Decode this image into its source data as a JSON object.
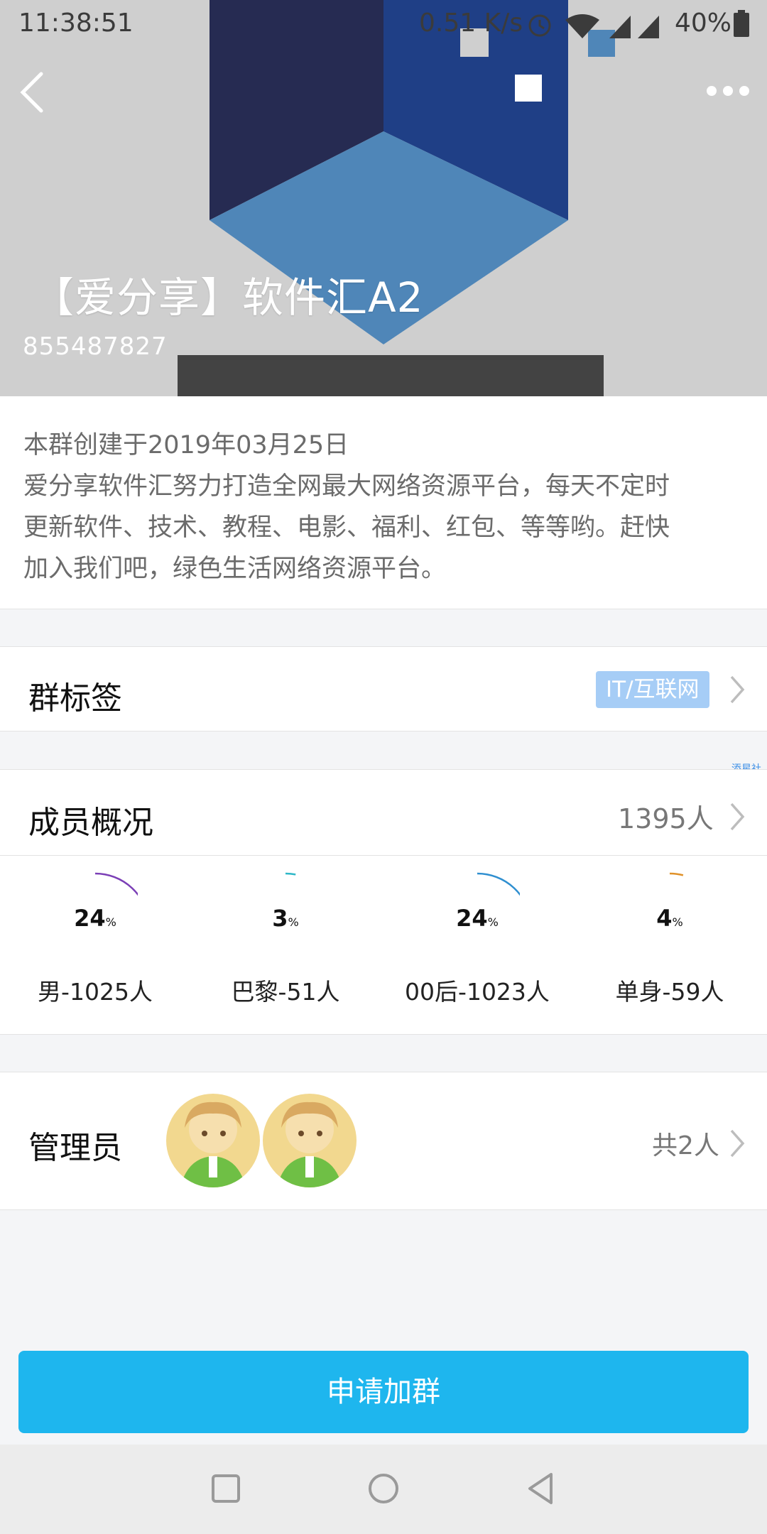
{
  "status_bar": {
    "time": "11:38:51",
    "network_speed": "0.51 K/s",
    "battery": "40%"
  },
  "header": {
    "title": "【爱分享】软件汇A2",
    "group_id": "855487827",
    "cover_icon": "cube-logo",
    "back_icon": "back-arrow-icon",
    "more_icon": "more-dots-icon"
  },
  "description": {
    "lines": [
      "本群创建于2019年03月25日",
      "爱分享软件汇努力打造全网最大网络资源平台，每天不定时",
      "更新软件、技术、教程、电影、福利、红包、等等哟。赶快",
      "加入我们吧，绿色生活网络资源平台。"
    ]
  },
  "tags": {
    "label": "群标签",
    "value": "IT/互联网",
    "side_link": "添星社区"
  },
  "members": {
    "label": "成员概况",
    "count": "1395人",
    "stats": [
      {
        "value": "24",
        "unit": "%",
        "label": "男-1025人",
        "color": "#7b3fb6",
        "fraction": 0.24
      },
      {
        "value": "3",
        "unit": "%",
        "label": "巴黎-51人",
        "color": "#2fb8c8",
        "fraction": 0.03
      },
      {
        "value": "24",
        "unit": "%",
        "label": "00后-1023人",
        "color": "#2f8fd0",
        "fraction": 0.24
      },
      {
        "value": "4",
        "unit": "%",
        "label": "单身-59人",
        "color": "#e0922a",
        "fraction": 0.04
      }
    ]
  },
  "admins": {
    "label": "管理员",
    "count": "共2人"
  },
  "actions": {
    "join_label": "申请加群"
  },
  "colors": {
    "accent": "#1eb6ee",
    "tag_bg": "#a6cdf6"
  }
}
